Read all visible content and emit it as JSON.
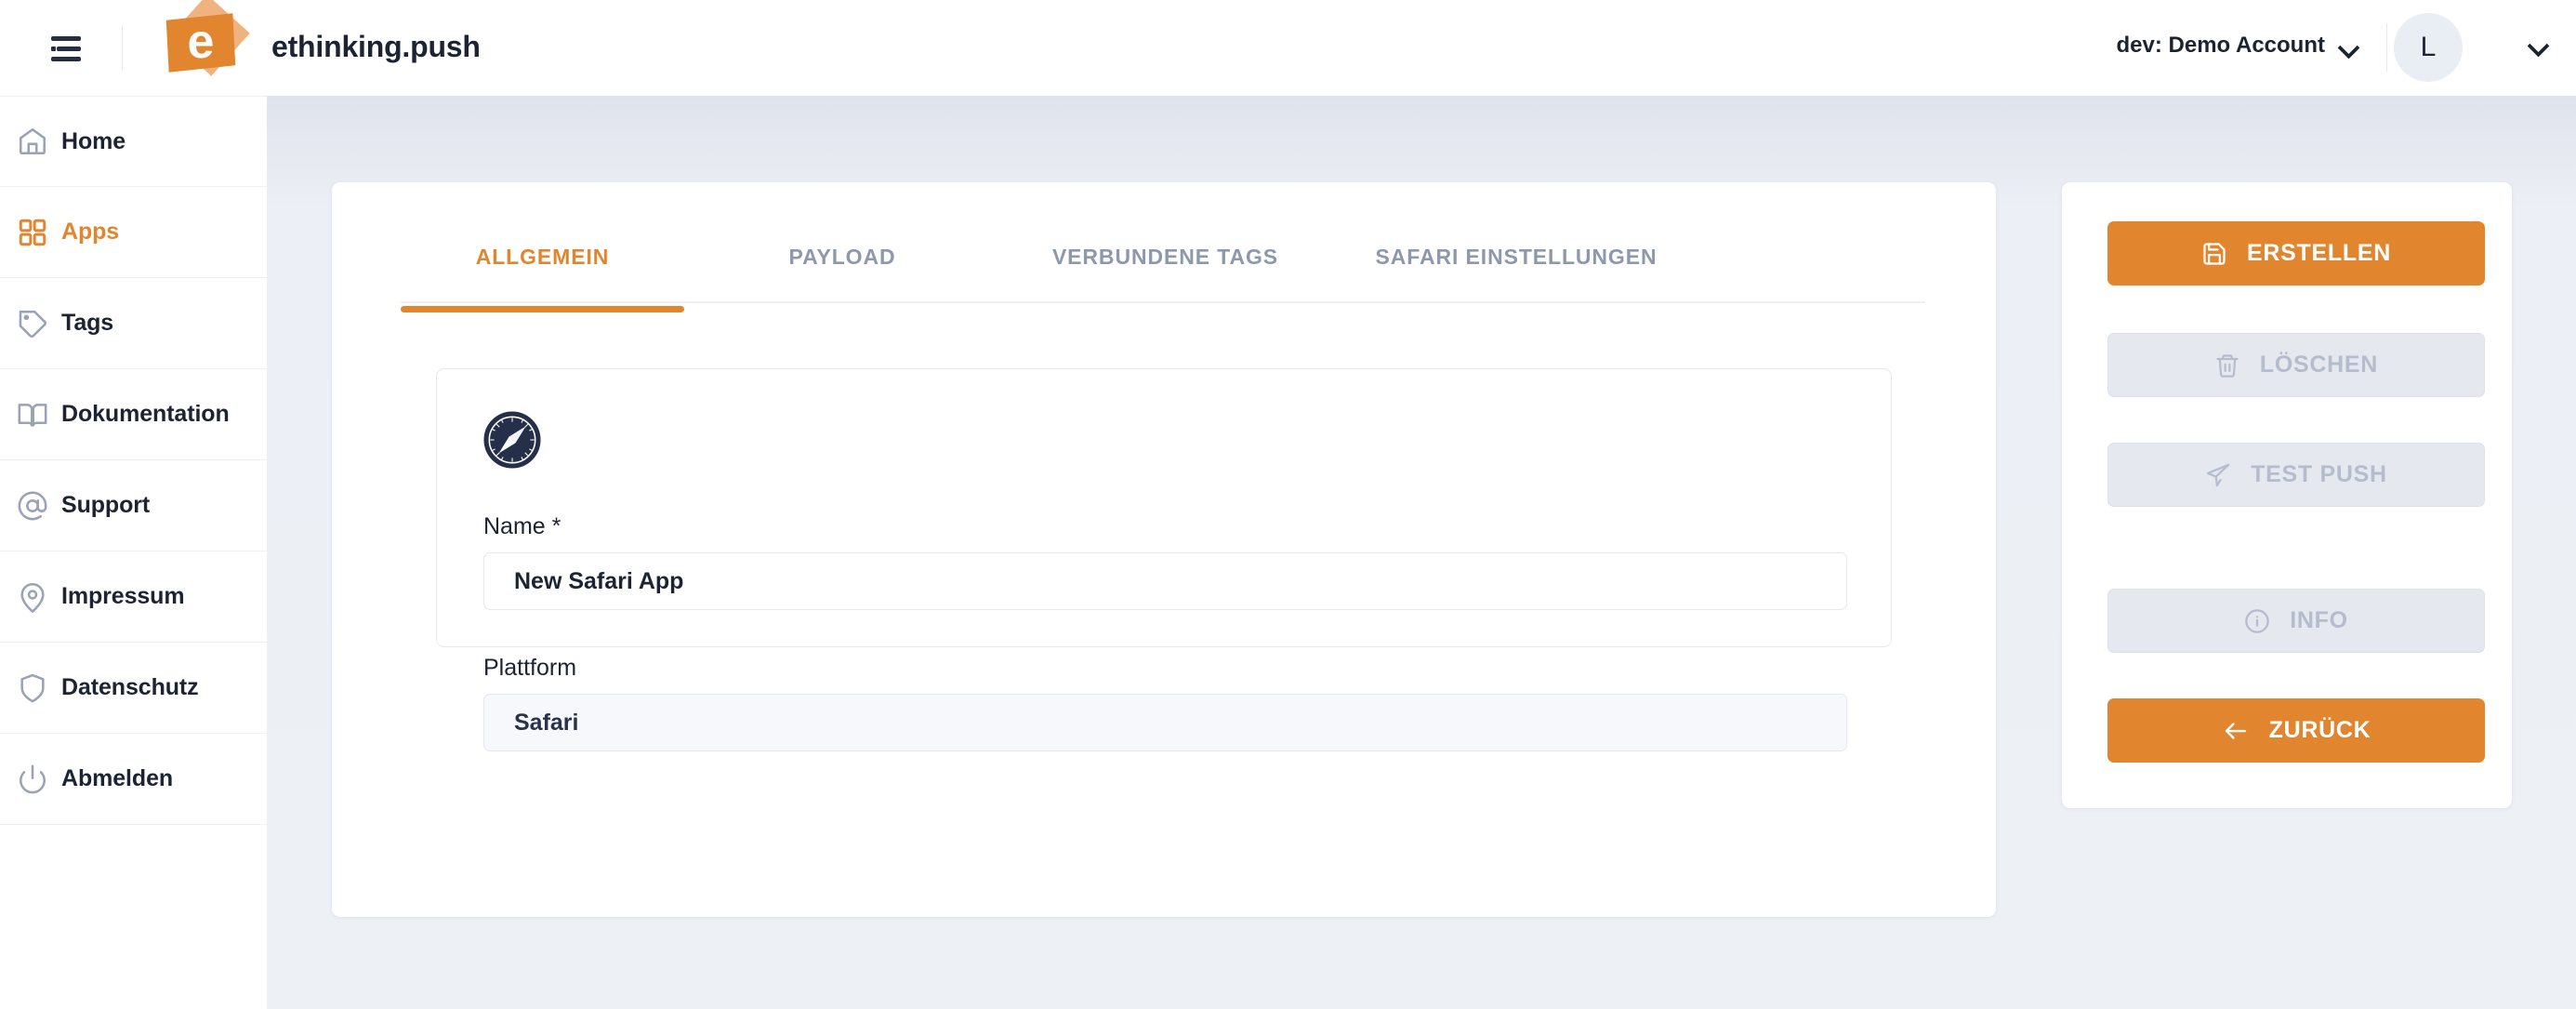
{
  "header": {
    "menu_icon": "hamburger-menu-icon",
    "brand": "ethinking.push",
    "account_label": "dev: Demo Account",
    "avatar_initial": "L"
  },
  "sidebar": {
    "items": [
      {
        "label": "Home",
        "icon": "home-icon",
        "active": false
      },
      {
        "label": "Apps",
        "icon": "grid-icon",
        "active": true
      },
      {
        "label": "Tags",
        "icon": "tag-icon",
        "active": false
      },
      {
        "label": "Dokumentation",
        "icon": "book-icon",
        "active": false
      },
      {
        "label": "Support",
        "icon": "at-sign-icon",
        "active": false
      },
      {
        "label": "Impressum",
        "icon": "map-pin-icon",
        "active": false
      },
      {
        "label": "Datenschutz",
        "icon": "shield-icon",
        "active": false
      },
      {
        "label": "Abmelden",
        "icon": "power-icon",
        "active": false
      }
    ]
  },
  "main": {
    "tabs": [
      {
        "label": "ALLGEMEIN",
        "active": true
      },
      {
        "label": "PAYLOAD",
        "active": false
      },
      {
        "label": "VERBUNDENE TAGS",
        "active": false
      },
      {
        "label": "SAFARI EINSTELLUNGEN",
        "active": false
      }
    ],
    "app_icon": "safari-compass-icon",
    "fields": [
      {
        "label": "Name *",
        "value": "New Safari App",
        "disabled": false
      },
      {
        "label": "Plattform",
        "value": "Safari",
        "disabled": true
      }
    ]
  },
  "actions": [
    {
      "label": "ERSTELLEN",
      "icon": "save-icon",
      "style": "primary",
      "disabled": false
    },
    {
      "label": "LÖSCHEN",
      "icon": "trash-icon",
      "style": "disabled",
      "disabled": true
    },
    {
      "label": "TEST PUSH",
      "icon": "send-icon",
      "style": "disabled",
      "disabled": true
    },
    {
      "label": "INFO",
      "icon": "info-circle-icon",
      "style": "disabled",
      "disabled": true
    },
    {
      "label": "ZURÜCK",
      "icon": "arrow-left-icon",
      "style": "primary",
      "disabled": false
    }
  ],
  "colors": {
    "accent": "#e2852f",
    "text_dark": "#1c2333",
    "muted": "#8e98ad",
    "page_bg": "#edf0f5"
  }
}
